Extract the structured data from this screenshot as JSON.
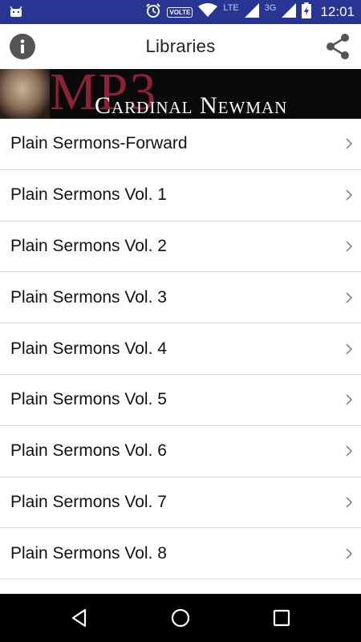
{
  "status_bar": {
    "volte": "VOLTE",
    "network_lte": "LTE",
    "network_3g": "3G",
    "time": "12:01"
  },
  "app_bar": {
    "title": "Libraries",
    "icons": [
      "info-icon",
      "share-icon"
    ]
  },
  "banner": {
    "mp3_text": "MP3",
    "name_text": "Cardinal Newman"
  },
  "libraries": [
    "Plain Sermons-Forward",
    "Plain Sermons Vol. 1",
    "Plain Sermons Vol. 2",
    "Plain Sermons Vol. 3",
    "Plain Sermons Vol. 4",
    "Plain Sermons Vol. 5",
    "Plain Sermons Vol. 6",
    "Plain Sermons Vol. 7",
    "Plain Sermons Vol. 8"
  ],
  "nav_bar": {
    "icons": [
      "back-icon",
      "home-icon",
      "recents-icon"
    ]
  },
  "colors": {
    "status_bar": "#283593",
    "banner_accent": "#8b2236"
  }
}
